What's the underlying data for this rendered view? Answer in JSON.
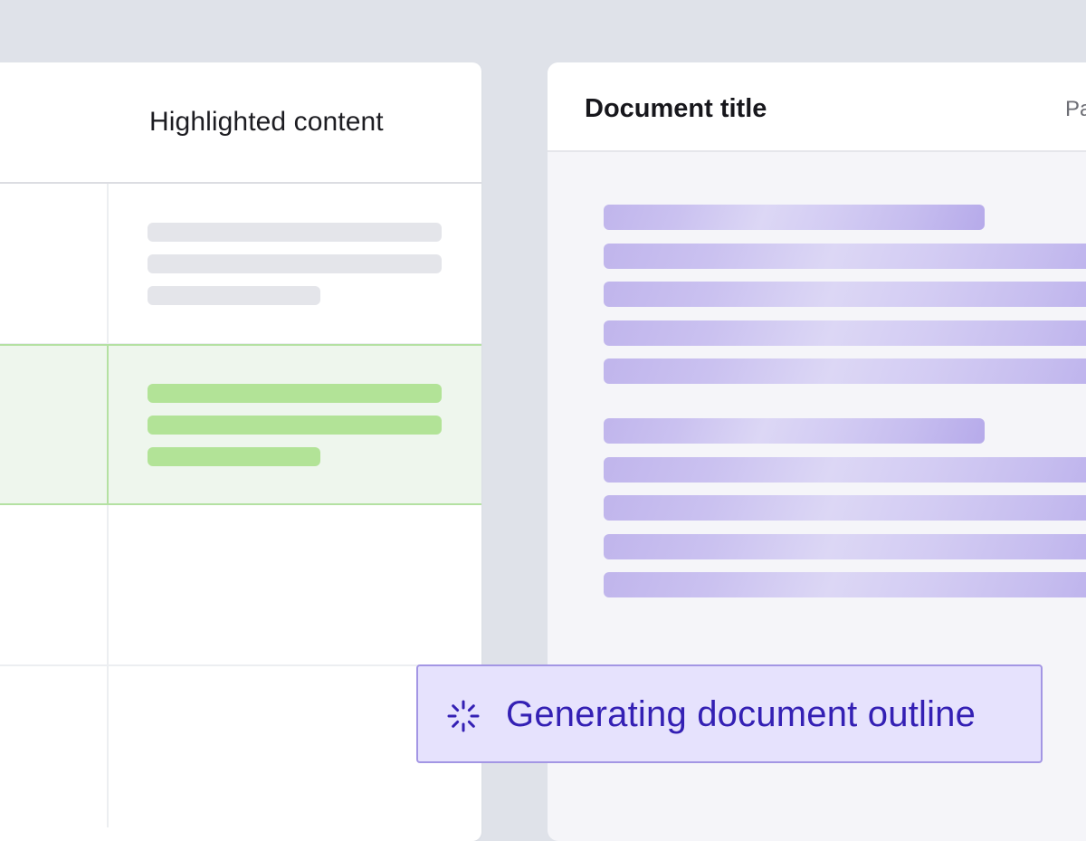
{
  "table": {
    "header_label": "Highlighted content"
  },
  "document": {
    "title": "Document title",
    "header_right_label": "Pa"
  },
  "status": {
    "message": "Generating document outline",
    "icon": "loading-spinner-icon"
  },
  "colors": {
    "highlight_row_background": "#eef6ed",
    "highlight_bar": "#b2e397",
    "generated_bar": "#c0b5ec",
    "toast_background": "#e6e2fd",
    "toast_text": "#3420b4"
  }
}
